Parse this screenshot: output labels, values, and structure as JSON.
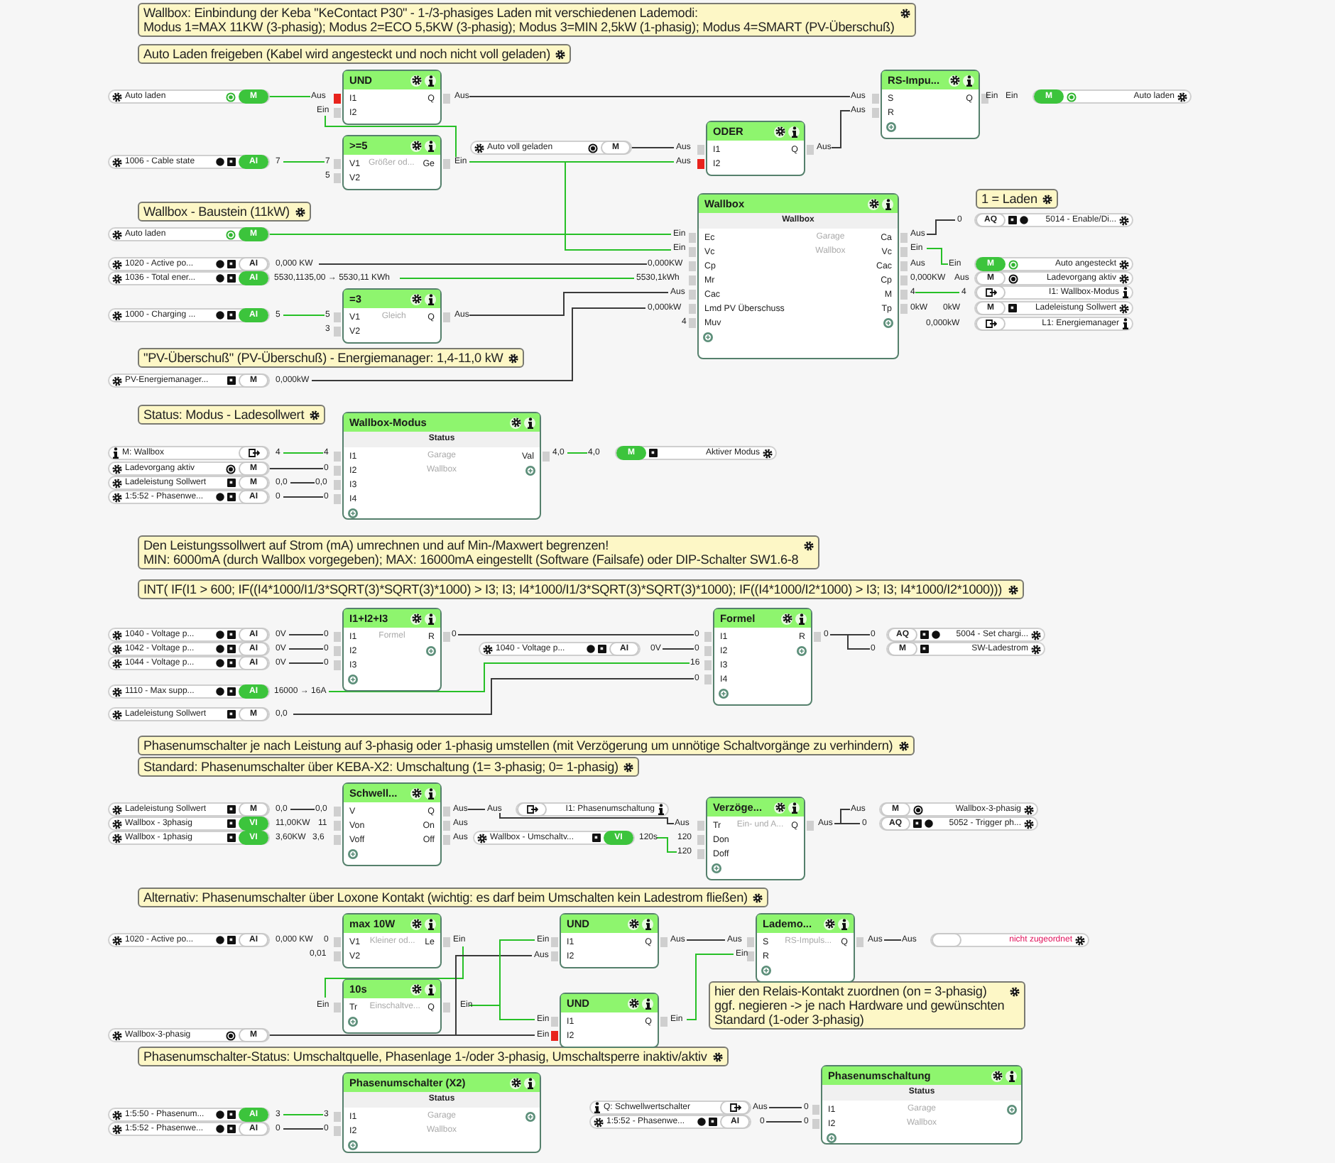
{
  "comments": [
    {
      "lines": [
        "Wallbox: Einbindung der Keba \"KeContact P30\" - 1-/3-phasiges Laden mit verschiedenen Lademodi:",
        "Modus 1=MAX 11KW (3-phasig); Modus 2=ECO 5,5KW (3-phasig); Modus 3=MIN 2,5kW (1-phasig); Modus 4=SMART (PV-Überschuß)"
      ]
    },
    {
      "lines": [
        "Auto Laden freigeben (Kabel wird angesteckt und noch nicht voll geladen)"
      ]
    },
    {
      "lines": [
        "Wallbox - Baustein (11kW)"
      ]
    },
    {
      "lines": [
        "1 = Laden"
      ]
    },
    {
      "lines": [
        "\"PV-Überschuß\"  (PV-Überschuß) - Energiemanager: 1,4-11,0 kW"
      ]
    },
    {
      "lines": [
        "Status: Modus - Ladesollwert"
      ]
    },
    {
      "lines": [
        "Den Leistungssollwert auf Strom (mA) umrechnen und auf Min-/Maxwert begrenzen!",
        "MIN: 6000mA (durch Wallbox vorgegeben); MAX: 16000mA eingestellt (Software (Failsafe) oder DIP-Schalter SW1.6-8"
      ]
    },
    {
      "lines": [
        "INT( IF(I1 > 600; IF((I4*1000/I1/3*SQRT(3)*SQRT(3)*1000) > I3; I3; I4*1000/I1/3*SQRT(3)*SQRT(3)*1000); IF((I4*1000/I2*1000) > I3; I3; I4*1000/I2*1000)))"
      ]
    },
    {
      "lines": [
        "Phasenumschalter je nach Leistung auf 3-phasig oder 1-phasig umstellen (mit Verzögerung um unnötige Schaltvorgänge zu verhindern)"
      ]
    },
    {
      "lines": [
        "Standard: Phasenumschalter über KEBA-X2: Umschaltung (1= 3-phasig; 0= 1-phasig)"
      ]
    },
    {
      "lines": [
        "Alternativ: Phasenumschalter über Loxone Kontakt (wichtig: es darf beim Umschalten kein Ladestrom fließen)"
      ]
    },
    {
      "lines": [
        "hier den Relais-Kontakt zuordnen (on = 3-phasig)",
        "ggf. negieren -> je nach Hardware und gewünschten",
        "Standard (1-oder 3-phasig)"
      ]
    },
    {
      "lines": [
        "Phasenumschalter-Status: Umschaltquelle, Phasenlage 1-/oder 3-phasig, Umschaltsperre inaktiv/aktiv"
      ]
    }
  ],
  "blocks": [
    {
      "title": "UND",
      "inputs": [
        {
          "label": "I1",
          "negated": true
        },
        {
          "label": "I2",
          "negated": false
        }
      ],
      "outputs": [
        "Q"
      ],
      "add_input": false,
      "add_output": false
    },
    {
      "title": ">=5",
      "notes": [
        "Größer od..."
      ],
      "inputs": [
        {
          "label": "V1",
          "negated": false
        },
        {
          "label": "V2",
          "negated": false
        }
      ],
      "outputs": [
        "Ge"
      ],
      "add_input": false,
      "add_output": false
    },
    {
      "title": "=3",
      "notes": [
        "Gleich"
      ],
      "inputs": [
        {
          "label": "V1",
          "negated": false
        },
        {
          "label": "V2",
          "negated": false
        }
      ],
      "outputs": [
        "Q"
      ],
      "add_input": false,
      "add_output": false
    },
    {
      "title": "ODER",
      "inputs": [
        {
          "label": "I1",
          "negated": false
        },
        {
          "label": "I2",
          "negated": true
        }
      ],
      "outputs": [
        "Q"
      ],
      "add_input": false,
      "add_output": false
    },
    {
      "title": "RS-Impu...",
      "inputs": [
        {
          "label": "S",
          "negated": false
        },
        {
          "label": "R",
          "negated": false
        }
      ],
      "outputs": [
        "Q"
      ],
      "add_input": true,
      "add_output": false
    },
    {
      "title": "Wallbox",
      "status": "Wallbox",
      "notes": [
        "Garage",
        "Wallbox"
      ],
      "inputs": [
        {
          "label": "Ec",
          "negated": false
        },
        {
          "label": "Vc",
          "negated": false
        },
        {
          "label": "Cp",
          "negated": false
        },
        {
          "label": "Mr",
          "negated": false
        },
        {
          "label": "Cac",
          "negated": false
        },
        {
          "label": "Lmd PV Überschuss",
          "negated": false
        },
        {
          "label": "Muv",
          "negated": false
        }
      ],
      "outputs": [
        "Ca",
        "Vc",
        "Cac",
        "Cp",
        "M",
        "Tp"
      ],
      "add_input": true,
      "add_output": true
    },
    {
      "title": "Wallbox-Modus",
      "status": "Status",
      "notes": [
        "Garage",
        "Wallbox"
      ],
      "inputs": [
        {
          "label": "I1",
          "negated": false
        },
        {
          "label": "I2",
          "negated": false
        },
        {
          "label": "I3",
          "negated": false
        },
        {
          "label": "I4",
          "negated": false
        }
      ],
      "outputs": [
        "Val"
      ],
      "add_input": true,
      "add_output": true
    },
    {
      "title": "I1+I2+I3",
      "notes": [
        "Formel"
      ],
      "inputs": [
        {
          "label": "I1",
          "negated": false
        },
        {
          "label": "I2",
          "negated": false
        },
        {
          "label": "I3",
          "negated": false
        }
      ],
      "outputs": [
        "R"
      ],
      "add_input": true,
      "add_output": true
    },
    {
      "title": "Formel",
      "inputs": [
        {
          "label": "I1",
          "negated": false
        },
        {
          "label": "I2",
          "negated": false
        },
        {
          "label": "I3",
          "negated": false
        },
        {
          "label": "I4",
          "negated": false
        }
      ],
      "outputs": [
        "R"
      ],
      "add_input": true,
      "add_output": true
    },
    {
      "title": "Schwell...",
      "inputs": [
        {
          "label": "V",
          "negated": false
        },
        {
          "label": "Von",
          "negated": false
        },
        {
          "label": "Voff",
          "negated": false
        }
      ],
      "outputs": [
        "Q",
        "On",
        "Off"
      ],
      "add_input": true,
      "add_output": false
    },
    {
      "title": "Verzöge...",
      "notes": [
        "Ein- und A..."
      ],
      "inputs": [
        {
          "label": "Tr",
          "negated": false
        },
        {
          "label": "Don",
          "negated": false
        },
        {
          "label": "Doff",
          "negated": false
        }
      ],
      "outputs": [
        "Q"
      ],
      "add_input": true,
      "add_output": false
    },
    {
      "title": "max 10W",
      "notes": [
        "Kleiner od..."
      ],
      "inputs": [
        {
          "label": "V1",
          "negated": false
        },
        {
          "label": "V2",
          "negated": false
        }
      ],
      "outputs": [
        "Le"
      ],
      "add_input": false,
      "add_output": false
    },
    {
      "title": "10s",
      "notes": [
        "Einschaltve..."
      ],
      "inputs": [
        {
          "label": "Tr",
          "negated": false
        }
      ],
      "outputs": [
        "Q"
      ],
      "add_input": true,
      "add_output": false
    },
    {
      "title": "UND",
      "inputs": [
        {
          "label": "I1",
          "negated": false
        },
        {
          "label": "I2",
          "negated": false
        }
      ],
      "outputs": [
        "Q"
      ],
      "add_input": false,
      "add_output": false
    },
    {
      "title": "UND",
      "inputs": [
        {
          "label": "I1",
          "negated": false
        },
        {
          "label": "I2",
          "negated": true
        }
      ],
      "outputs": [
        "Q"
      ],
      "add_input": false,
      "add_output": false
    },
    {
      "title": "Lademo...",
      "notes": [
        "RS-Impuls..."
      ],
      "inputs": [
        {
          "label": "S",
          "negated": false
        },
        {
          "label": "R",
          "negated": false
        }
      ],
      "outputs": [
        "Q"
      ],
      "add_input": true,
      "add_output": false
    },
    {
      "title": "Phasenumschalter (X2)",
      "status": "Status",
      "notes": [
        "Garage",
        "Wallbox"
      ],
      "inputs": [
        {
          "label": "I1",
          "negated": false
        },
        {
          "label": "I2",
          "negated": false
        }
      ],
      "add_input": true,
      "add_output": true
    },
    {
      "title": "Phasenumschaltung",
      "status": "Status",
      "notes": [
        "Garage",
        "Wallbox"
      ],
      "inputs": [
        {
          "label": "I1",
          "negated": false
        },
        {
          "label": "I2",
          "negated": false
        }
      ],
      "add_input": true,
      "add_output": true
    }
  ],
  "pills": [
    {
      "kind": "input",
      "name": "Auto laden",
      "reference": false,
      "tag": "M",
      "active": true,
      "unassigned": false,
      "indicators": [
        {
          "kind": "lamp",
          "on": true
        }
      ]
    },
    {
      "kind": "input",
      "name": "1006 - Cable state",
      "reference": false,
      "tag": "AI",
      "active": true,
      "unassigned": false,
      "indicators": [
        {
          "kind": "dot"
        },
        {
          "kind": "square"
        }
      ]
    },
    {
      "kind": "input",
      "name": "Auto laden",
      "reference": false,
      "tag": "M",
      "active": true,
      "unassigned": false,
      "indicators": [
        {
          "kind": "lamp",
          "on": true
        }
      ]
    },
    {
      "kind": "input",
      "name": "1020 - Active po...",
      "reference": false,
      "tag": "AI",
      "active": false,
      "unassigned": false,
      "indicators": [
        {
          "kind": "dot"
        },
        {
          "kind": "square"
        }
      ]
    },
    {
      "kind": "input",
      "name": "1036 - Total ener...",
      "reference": false,
      "tag": "AI",
      "active": true,
      "unassigned": false,
      "indicators": [
        {
          "kind": "dot"
        },
        {
          "kind": "square"
        }
      ]
    },
    {
      "kind": "input",
      "name": "1000 - Charging ...",
      "reference": false,
      "tag": "AI",
      "active": true,
      "unassigned": false,
      "indicators": [
        {
          "kind": "dot"
        },
        {
          "kind": "square"
        }
      ]
    },
    {
      "kind": "input",
      "name": "PV-Energiemanager...",
      "reference": false,
      "tag": "M",
      "active": false,
      "unassigned": false,
      "indicators": [
        {
          "kind": "square"
        }
      ]
    },
    {
      "kind": "input",
      "name": "Auto voll geladen",
      "reference": false,
      "tag": "M",
      "active": false,
      "unassigned": false,
      "indicators": [
        {
          "kind": "lamp",
          "on": false
        }
      ]
    },
    {
      "kind": "input",
      "name": "M: Wallbox",
      "reference": true,
      "active": false,
      "unassigned": false
    },
    {
      "kind": "input",
      "name": "Ladevorgang aktiv",
      "reference": false,
      "tag": "M",
      "active": false,
      "unassigned": false,
      "indicators": [
        {
          "kind": "lamp",
          "on": false
        }
      ]
    },
    {
      "kind": "input",
      "name": "Ladeleistung Sollwert",
      "reference": false,
      "tag": "M",
      "active": false,
      "unassigned": false,
      "indicators": [
        {
          "kind": "square"
        }
      ]
    },
    {
      "kind": "input",
      "name": "1:5:52 - Phasenwe...",
      "reference": false,
      "tag": "AI",
      "active": false,
      "unassigned": false,
      "indicators": [
        {
          "kind": "dot"
        },
        {
          "kind": "square"
        }
      ]
    },
    {
      "kind": "input",
      "name": "1040 - Voltage p...",
      "reference": false,
      "tag": "AI",
      "active": false,
      "unassigned": false,
      "indicators": [
        {
          "kind": "dot"
        },
        {
          "kind": "square"
        }
      ]
    },
    {
      "kind": "input",
      "name": "1042 - Voltage p...",
      "reference": false,
      "tag": "AI",
      "active": false,
      "unassigned": false,
      "indicators": [
        {
          "kind": "dot"
        },
        {
          "kind": "square"
        }
      ]
    },
    {
      "kind": "input",
      "name": "1044 - Voltage p...",
      "reference": false,
      "tag": "AI",
      "active": false,
      "unassigned": false,
      "indicators": [
        {
          "kind": "dot"
        },
        {
          "kind": "square"
        }
      ]
    },
    {
      "kind": "input",
      "name": "1110 - Max supp...",
      "reference": false,
      "tag": "AI",
      "active": true,
      "unassigned": false,
      "indicators": [
        {
          "kind": "dot"
        },
        {
          "kind": "square"
        }
      ]
    },
    {
      "kind": "input",
      "name": "Ladeleistung Sollwert",
      "reference": false,
      "tag": "M",
      "active": false,
      "unassigned": false,
      "indicators": [
        {
          "kind": "square"
        }
      ]
    },
    {
      "kind": "input",
      "name": "1040 - Voltage p...",
      "reference": false,
      "tag": "AI",
      "active": false,
      "unassigned": false,
      "indicators": [
        {
          "kind": "dot"
        },
        {
          "kind": "square"
        }
      ]
    },
    {
      "kind": "input",
      "name": "Ladeleistung Sollwert",
      "reference": false,
      "tag": "M",
      "active": false,
      "unassigned": false,
      "indicators": [
        {
          "kind": "square"
        }
      ]
    },
    {
      "kind": "input",
      "name": "Wallbox - 3phasig",
      "reference": false,
      "tag": "VI",
      "active": true,
      "unassigned": false,
      "indicators": [
        {
          "kind": "square"
        }
      ]
    },
    {
      "kind": "input",
      "name": "Wallbox - 1phasig",
      "reference": false,
      "tag": "VI",
      "active": true,
      "unassigned": false,
      "indicators": [
        {
          "kind": "square"
        }
      ]
    },
    {
      "kind": "input",
      "name": "Wallbox - Umschaltv...",
      "reference": false,
      "tag": "VI",
      "active": true,
      "unassigned": false,
      "indicators": [
        {
          "kind": "square"
        }
      ]
    },
    {
      "kind": "input",
      "name": "1020 - Active po...",
      "reference": false,
      "tag": "AI",
      "active": false,
      "unassigned": false,
      "indicators": [
        {
          "kind": "dot"
        },
        {
          "kind": "square"
        }
      ]
    },
    {
      "kind": "input",
      "name": "Wallbox-3-phasig",
      "reference": false,
      "tag": "M",
      "active": false,
      "unassigned": false,
      "indicators": [
        {
          "kind": "lamp",
          "on": false
        }
      ]
    },
    {
      "kind": "input",
      "name": "1:5:50 - Phasenum...",
      "reference": false,
      "tag": "AI",
      "active": true,
      "unassigned": false,
      "indicators": [
        {
          "kind": "dot"
        },
        {
          "kind": "square"
        }
      ]
    },
    {
      "kind": "input",
      "name": "1:5:52 - Phasenwe...",
      "reference": false,
      "tag": "AI",
      "active": false,
      "unassigned": false,
      "indicators": [
        {
          "kind": "dot"
        },
        {
          "kind": "square"
        }
      ]
    },
    {
      "kind": "input",
      "name": "Q: Schwellwertschalter",
      "reference": true,
      "active": false,
      "unassigned": false
    },
    {
      "kind": "input",
      "name": "1:5:52 - Phasenwe...",
      "reference": false,
      "tag": "AI",
      "active": false,
      "unassigned": false,
      "indicators": [
        {
          "kind": "dot"
        },
        {
          "kind": "square"
        }
      ]
    },
    {
      "kind": "output",
      "name": "Auto laden",
      "reference": false,
      "tag": "M",
      "active": true,
      "unassigned": false,
      "indicators": [
        {
          "kind": "lamp",
          "on": true
        }
      ]
    },
    {
      "kind": "output",
      "name": "5014 - Enable/Di...",
      "reference": false,
      "tag": "AQ",
      "active": false,
      "unassigned": false,
      "indicators": [
        {
          "kind": "square"
        },
        {
          "kind": "dot"
        }
      ]
    },
    {
      "kind": "output",
      "name": "Auto angesteckt",
      "reference": false,
      "tag": "M",
      "active": true,
      "unassigned": false,
      "indicators": [
        {
          "kind": "lamp",
          "on": true
        }
      ]
    },
    {
      "kind": "output",
      "name": "Ladevorgang aktiv",
      "reference": false,
      "tag": "M",
      "active": false,
      "unassigned": false,
      "indicators": [
        {
          "kind": "lamp",
          "on": false
        }
      ]
    },
    {
      "kind": "output",
      "name": "I1: Wallbox-Modus",
      "reference": true,
      "active": false,
      "unassigned": false
    },
    {
      "kind": "output",
      "name": "Ladeleistung Sollwert",
      "reference": false,
      "tag": "M",
      "active": false,
      "unassigned": false,
      "indicators": [
        {
          "kind": "square"
        }
      ]
    },
    {
      "kind": "output",
      "name": "L1: Energiemanager",
      "reference": true,
      "active": false,
      "unassigned": false
    },
    {
      "kind": "output",
      "name": "Aktiver Modus",
      "reference": false,
      "tag": "M",
      "active": true,
      "unassigned": false,
      "indicators": [
        {
          "kind": "square"
        }
      ]
    },
    {
      "kind": "output",
      "name": "5004 - Set chargi...",
      "reference": false,
      "tag": "AQ",
      "active": false,
      "unassigned": false,
      "indicators": [
        {
          "kind": "square"
        },
        {
          "kind": "dot"
        }
      ]
    },
    {
      "kind": "output",
      "name": "SW-Ladestrom",
      "reference": false,
      "tag": "M",
      "active": false,
      "unassigned": false,
      "indicators": [
        {
          "kind": "square"
        }
      ]
    },
    {
      "kind": "output",
      "name": "I1: Phasenumschaltung",
      "reference": true,
      "active": false,
      "unassigned": false
    },
    {
      "kind": "output",
      "name": "Wallbox-3-phasig",
      "reference": false,
      "tag": "M",
      "active": false,
      "unassigned": false,
      "indicators": [
        {
          "kind": "lamp",
          "on": false
        }
      ]
    },
    {
      "kind": "output",
      "name": "5052 - Trigger ph...",
      "reference": false,
      "tag": "AQ",
      "active": false,
      "unassigned": false,
      "indicators": [
        {
          "kind": "square"
        },
        {
          "kind": "dot"
        }
      ]
    },
    {
      "kind": "output",
      "name": "nicht zugeordnet",
      "reference": false,
      "active": false,
      "unassigned": true
    }
  ],
  "wire_labels": [
    "Aus",
    "Ein",
    "Aus",
    "Aus",
    "Aus",
    "Ein",
    "Ein",
    "7",
    "7",
    "5",
    "Ein",
    "Aus",
    "Aus",
    "Aus",
    "0,000 KW",
    "5530,1135,00 → 5530,11  KWh",
    "5",
    "5",
    "3",
    "Aus",
    "0,000kW",
    "Ein",
    "Ein",
    "0,000KW",
    "5530,1kWh",
    "Aus",
    "0,000kW",
    "4",
    "Aus",
    "Ein",
    "Aus",
    "0,000KW",
    "4",
    "0kW",
    "0",
    "Ein",
    "Aus",
    "4",
    "0kW",
    "0,000kW",
    "4",
    "4",
    "0",
    "0,0",
    "0,0",
    "0",
    "0",
    "4,0",
    "4,0",
    "0V",
    "0",
    "0V",
    "0",
    "0V",
    "0",
    "0",
    "16000 → 16A",
    "0,0",
    "0V",
    "0",
    "0",
    "16",
    "0",
    "0",
    "0",
    "0",
    "0,0",
    "0,0",
    "11,00KW",
    "11",
    "3,60KW",
    "3,6",
    "Aus",
    "Aus",
    "Aus",
    "Aus",
    "120s",
    "Aus",
    "120",
    "120",
    "Aus",
    "Aus",
    "0",
    "0,000 KW",
    "0",
    "0,01",
    "Ein",
    "Ein",
    "Ein",
    "Ein",
    "Aus",
    "Ein",
    "Ein",
    "Aus",
    "Aus",
    "Ein",
    "Ein",
    "Aus",
    "Aus",
    "3",
    "3",
    "0",
    "0",
    "Aus",
    "0",
    "0",
    "0"
  ],
  "wires": [
    {
      "on": true
    },
    {
      "on": true
    },
    {
      "on": false
    },
    {
      "on": true
    },
    {
      "on": true
    },
    {
      "on": false
    },
    {
      "on": false
    },
    {
      "on": true
    },
    {
      "on": false
    },
    {
      "on": true
    },
    {
      "on": false
    },
    {
      "on": false
    },
    {
      "on": true
    },
    {
      "on": false
    },
    {
      "on": true
    },
    {
      "on": true
    },
    {
      "on": true
    },
    {
      "on": false
    },
    {
      "on": false
    },
    {
      "on": false
    },
    {
      "on": true
    },
    {
      "on": false
    },
    {
      "on": false
    },
    {
      "on": false
    },
    {
      "on": true
    },
    {
      "on": false
    },
    {
      "on": false
    },
    {
      "on": false
    },
    {
      "on": false
    },
    {
      "on": false
    },
    {
      "on": false
    },
    {
      "on": false
    },
    {
      "on": true
    },
    {
      "on": false
    },
    {
      "on": true
    },
    {
      "on": false
    },
    {
      "on": true
    },
    {
      "on": false
    },
    {
      "on": true
    },
    {
      "on": false
    },
    {
      "on": true
    },
    {
      "on": false
    },
    {
      "on": false
    },
    {
      "on": false
    }
  ]
}
